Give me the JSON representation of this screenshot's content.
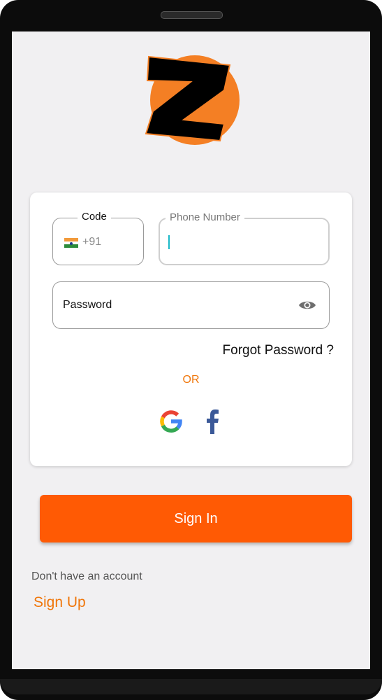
{
  "login": {
    "code_label": "Code",
    "country_code": "+91",
    "phone_label": "Phone Number",
    "password_placeholder": "Password",
    "forgot_password": "Forgot Password ?",
    "or_text": "OR",
    "signin_label": "Sign In",
    "no_account_text": "Don't have an account",
    "signup_label": "Sign Up"
  },
  "icons": {
    "logo": "z-logo",
    "flag": "india-flag-icon",
    "eye": "eye-icon",
    "google": "google-icon",
    "facebook": "facebook-icon"
  },
  "colors": {
    "accent": "#ff5a04",
    "logo_circle": "#f47f24",
    "or_text": "#f0760a",
    "cursor": "#19b8c8"
  }
}
